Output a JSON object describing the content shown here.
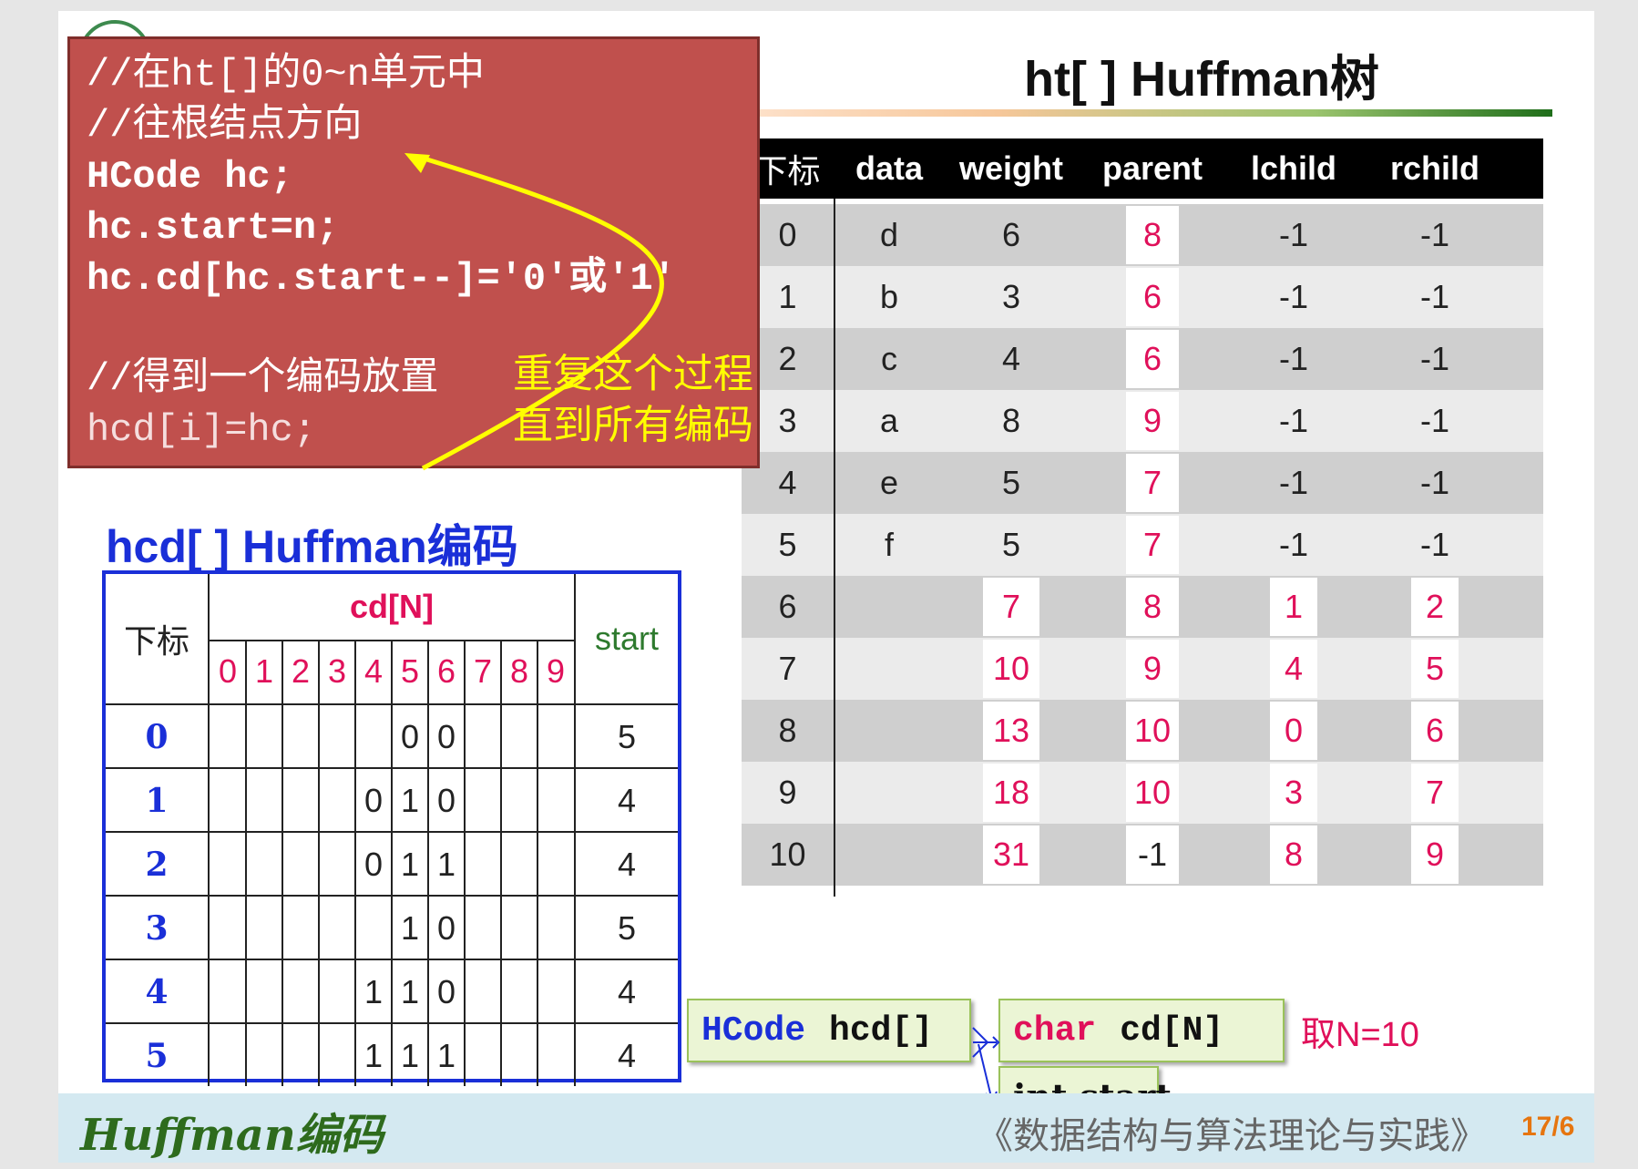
{
  "slide_title": "ht[ ] Huffman树",
  "code_box": {
    "lines": [
      "//在ht[]的0~n单元中",
      "//往根结点方向",
      "HCode hc;",
      "hc.start=n;",
      "hc.cd[hc.start--]='0'或'1'",
      "//得到一个编码放置",
      "hcd[i]=hc;"
    ],
    "note_lines": [
      "重复这个过程",
      "直到所有编码"
    ]
  },
  "ht_table": {
    "headers": [
      "下标",
      "data",
      "weight",
      "parent",
      "lchild",
      "rchild"
    ],
    "rows": [
      [
        "0",
        "d",
        "6",
        "8",
        "-1",
        "-1"
      ],
      [
        "1",
        "b",
        "3",
        "6",
        "-1",
        "-1"
      ],
      [
        "2",
        "c",
        "4",
        "6",
        "-1",
        "-1"
      ],
      [
        "3",
        "a",
        "8",
        "9",
        "-1",
        "-1"
      ],
      [
        "4",
        "e",
        "5",
        "7",
        "-1",
        "-1"
      ],
      [
        "5",
        "f",
        "5",
        "7",
        "-1",
        "-1"
      ],
      [
        "6",
        "",
        "7",
        "8",
        "1",
        "2"
      ],
      [
        "7",
        "",
        "10",
        "9",
        "4",
        "5"
      ],
      [
        "8",
        "",
        "13",
        "10",
        "0",
        "6"
      ],
      [
        "9",
        "",
        "18",
        "10",
        "3",
        "7"
      ],
      [
        "10",
        "",
        "31",
        "-1",
        "8",
        "9"
      ]
    ]
  },
  "hcd_title": "hcd[ ] Huffman编码",
  "hcd_table": {
    "index_header": "下标",
    "cd_header": "cd[N]",
    "start_header": "start",
    "cd_indices": [
      "0",
      "1",
      "2",
      "3",
      "4",
      "5",
      "6",
      "7",
      "8",
      "9"
    ],
    "rows": [
      {
        "index": "0",
        "cd": [
          "",
          "",
          "",
          "",
          "",
          "0",
          "0",
          "",
          "",
          ""
        ],
        "start": "5"
      },
      {
        "index": "1",
        "cd": [
          "",
          "",
          "",
          "",
          "0",
          "1",
          "0",
          "",
          "",
          ""
        ],
        "start": "4"
      },
      {
        "index": "2",
        "cd": [
          "",
          "",
          "",
          "",
          "0",
          "1",
          "1",
          "",
          "",
          ""
        ],
        "start": "4"
      },
      {
        "index": "3",
        "cd": [
          "",
          "",
          "",
          "",
          "",
          "1",
          "0",
          "",
          "",
          ""
        ],
        "start": "5"
      },
      {
        "index": "4",
        "cd": [
          "",
          "",
          "",
          "",
          "1",
          "1",
          "0",
          "",
          "",
          ""
        ],
        "start": "4"
      },
      {
        "index": "5",
        "cd": [
          "",
          "",
          "",
          "",
          "1",
          "1",
          "1",
          "",
          "",
          ""
        ],
        "start": "4"
      }
    ]
  },
  "structs": {
    "hcode_type": "HCode",
    "hcode_var": "hcd[]",
    "char_type": "char",
    "char_var": "cd[N]",
    "int_field": "int start",
    "n_note": "取N=10"
  },
  "footer": {
    "left": "Huffman编码",
    "book": "《数据结构与算法理论与实践》",
    "page": "17/6"
  },
  "colors": {
    "code_box": "#c0504d",
    "annotation": "#ffff00",
    "highlight_values": "#e0105a",
    "hcd_blue": "#1a2fd8",
    "footer_bg": "#d4e9f1"
  }
}
